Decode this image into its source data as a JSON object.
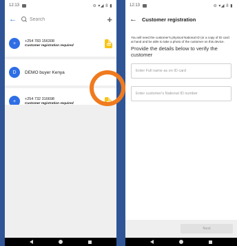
{
  "left_screen": {
    "status": {
      "time": "12:13",
      "icons": "⊖ ▾◢ 8 ▮"
    },
    "search": {
      "placeholder": "Search"
    },
    "items": [
      {
        "avatar_letter": "+",
        "title": "+254 783 156308",
        "subtitle": "Customer registration required"
      },
      {
        "avatar_letter": "D",
        "title": "DEMO buyer Kenya",
        "subtitle": ""
      },
      {
        "avatar_letter": "+",
        "title": "+254 732 316698",
        "subtitle": "Customer registration required"
      }
    ]
  },
  "right_screen": {
    "status": {
      "time": "12:13",
      "icons": "⊖ ▾◢ 8 ▮"
    },
    "title": "Customer registration",
    "info": "You will need the customer's physical National ID (or a copy of ID card at hand and be able to take a photo of the customer on this device.",
    "heading": "Provide the details below to verify the customer",
    "fields": {
      "full_name_placeholder": "Enter Full name as on ID card",
      "national_id_placeholder": "Enter customer's National ID number"
    },
    "next_label": "Next"
  },
  "colors": {
    "background": "#2f5597",
    "accent": "#2f6ee5",
    "doc_icon": "#f5c518",
    "highlight": "#f07a1e"
  }
}
